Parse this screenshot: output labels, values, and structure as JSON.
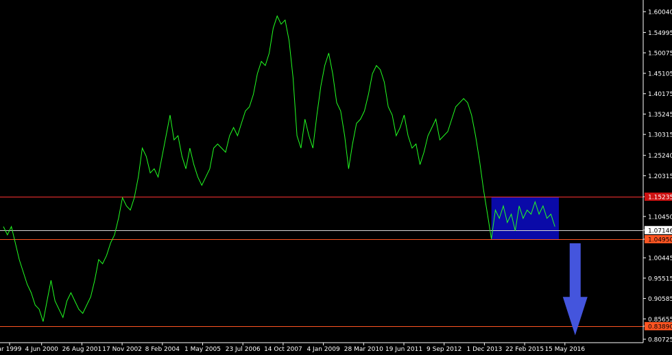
{
  "chart_data": {
    "type": "line",
    "title": "",
    "xlabel": "",
    "ylabel": "",
    "x_ticks": [
      "ar 1999",
      "4 Jun 2000",
      "26 Aug 2001",
      "17 Nov 2002",
      "8 Feb 2004",
      "1 May 2005",
      "23 Jul 2006",
      "14 Oct 2007",
      "4 Jan 2009",
      "28 Mar 2010",
      "19 Jun 2011",
      "9 Sep 2012",
      "1 Dec 2013",
      "22 Feb 2015",
      "15 May 2016"
    ],
    "y_ticks": [
      "1.60040",
      "1.54995",
      "1.50075",
      "1.45105",
      "1.40175",
      "1.35245",
      "1.30315",
      "1.25240",
      "1.20315",
      "1.15235",
      "1.10450",
      "1.07146",
      "1.04950",
      "1.00445",
      "0.95515",
      "0.90585",
      "0.85655",
      "0.83890",
      "0.80725"
    ],
    "ylim": [
      0.80725,
      1.6004
    ],
    "grid": false,
    "series": [
      {
        "color": "#22ff22",
        "points": [
          [
            0,
            1.08
          ],
          [
            0.5,
            1.06
          ],
          [
            1,
            1.08
          ],
          [
            1.5,
            1.04
          ],
          [
            2,
            1.0
          ],
          [
            2.5,
            0.97
          ],
          [
            3,
            0.94
          ],
          [
            3.5,
            0.92
          ],
          [
            4,
            0.89
          ],
          [
            4.5,
            0.88
          ],
          [
            5,
            0.85
          ],
          [
            5.5,
            0.9
          ],
          [
            6,
            0.95
          ],
          [
            6.5,
            0.9
          ],
          [
            7,
            0.88
          ],
          [
            7.5,
            0.86
          ],
          [
            8,
            0.9
          ],
          [
            8.5,
            0.92
          ],
          [
            9,
            0.9
          ],
          [
            9.5,
            0.88
          ],
          [
            10,
            0.87
          ],
          [
            10.5,
            0.89
          ],
          [
            11,
            0.91
          ],
          [
            11.5,
            0.95
          ],
          [
            12,
            1.0
          ],
          [
            12.5,
            0.99
          ],
          [
            13,
            1.01
          ],
          [
            13.5,
            1.04
          ],
          [
            14,
            1.06
          ],
          [
            14.5,
            1.1
          ],
          [
            15,
            1.15
          ],
          [
            15.5,
            1.13
          ],
          [
            16,
            1.12
          ],
          [
            16.5,
            1.15
          ],
          [
            17,
            1.2
          ],
          [
            17.5,
            1.27
          ],
          [
            18,
            1.25
          ],
          [
            18.5,
            1.21
          ],
          [
            19,
            1.22
          ],
          [
            19.5,
            1.2
          ],
          [
            20,
            1.25
          ],
          [
            20.5,
            1.3
          ],
          [
            21,
            1.35
          ],
          [
            21.5,
            1.29
          ],
          [
            22,
            1.3
          ],
          [
            22.5,
            1.25
          ],
          [
            23,
            1.22
          ],
          [
            23.5,
            1.27
          ],
          [
            24,
            1.23
          ],
          [
            24.5,
            1.2
          ],
          [
            25,
            1.18
          ],
          [
            25.5,
            1.2
          ],
          [
            26,
            1.22
          ],
          [
            26.5,
            1.27
          ],
          [
            27,
            1.28
          ],
          [
            27.5,
            1.27
          ],
          [
            28,
            1.26
          ],
          [
            28.5,
            1.3
          ],
          [
            29,
            1.32
          ],
          [
            29.5,
            1.3
          ],
          [
            30,
            1.33
          ],
          [
            30.5,
            1.36
          ],
          [
            31,
            1.37
          ],
          [
            31.5,
            1.4
          ],
          [
            32,
            1.45
          ],
          [
            32.5,
            1.48
          ],
          [
            33,
            1.47
          ],
          [
            33.5,
            1.5
          ],
          [
            34,
            1.56
          ],
          [
            34.5,
            1.59
          ],
          [
            35,
            1.57
          ],
          [
            35.5,
            1.58
          ],
          [
            36,
            1.53
          ],
          [
            36.5,
            1.44
          ],
          [
            37,
            1.3
          ],
          [
            37.5,
            1.27
          ],
          [
            38,
            1.34
          ],
          [
            38.5,
            1.3
          ],
          [
            39,
            1.27
          ],
          [
            39.5,
            1.35
          ],
          [
            40,
            1.42
          ],
          [
            40.5,
            1.47
          ],
          [
            41,
            1.5
          ],
          [
            41.5,
            1.45
          ],
          [
            42,
            1.38
          ],
          [
            42.5,
            1.36
          ],
          [
            43,
            1.3
          ],
          [
            43.5,
            1.22
          ],
          [
            44,
            1.28
          ],
          [
            44.5,
            1.33
          ],
          [
            45,
            1.34
          ],
          [
            45.5,
            1.36
          ],
          [
            46,
            1.4
          ],
          [
            46.5,
            1.45
          ],
          [
            47,
            1.47
          ],
          [
            47.5,
            1.46
          ],
          [
            48,
            1.43
          ],
          [
            48.5,
            1.37
          ],
          [
            49,
            1.35
          ],
          [
            49.5,
            1.3
          ],
          [
            50,
            1.32
          ],
          [
            50.5,
            1.35
          ],
          [
            51,
            1.3
          ],
          [
            51.5,
            1.27
          ],
          [
            52,
            1.28
          ],
          [
            52.5,
            1.23
          ],
          [
            53,
            1.26
          ],
          [
            53.5,
            1.3
          ],
          [
            54,
            1.32
          ],
          [
            54.5,
            1.34
          ],
          [
            55,
            1.29
          ],
          [
            55.5,
            1.3
          ],
          [
            56,
            1.31
          ],
          [
            56.5,
            1.34
          ],
          [
            57,
            1.37
          ],
          [
            57.5,
            1.38
          ],
          [
            58,
            1.39
          ],
          [
            58.5,
            1.38
          ],
          [
            59,
            1.35
          ],
          [
            59.5,
            1.3
          ],
          [
            60,
            1.24
          ],
          [
            60.5,
            1.17
          ],
          [
            61,
            1.11
          ],
          [
            61.5,
            1.05
          ],
          [
            62,
            1.12
          ],
          [
            62.5,
            1.1
          ],
          [
            63,
            1.13
          ],
          [
            63.5,
            1.09
          ],
          [
            64,
            1.11
          ],
          [
            64.5,
            1.07
          ],
          [
            65,
            1.13
          ],
          [
            65.5,
            1.1
          ],
          [
            66,
            1.12
          ],
          [
            66.5,
            1.11
          ],
          [
            67,
            1.14
          ],
          [
            67.5,
            1.11
          ],
          [
            68,
            1.13
          ],
          [
            68.5,
            1.1
          ],
          [
            69,
            1.11
          ],
          [
            69.5,
            1.08
          ]
        ]
      }
    ],
    "levels": [
      {
        "value": 1.15235,
        "label": "1.15235",
        "color": "#ff3333",
        "label_bg": "#cc1111",
        "label_fg": "#ffffff"
      },
      {
        "value": 1.07146,
        "label": "1.07146",
        "color": "#d8d8d8",
        "label_bg": "#ffffff",
        "label_fg": "#000000"
      },
      {
        "value": 1.0495,
        "label": "1.04950",
        "color": "#ff5522",
        "label_bg": "#ff5522",
        "label_fg": "#000000"
      },
      {
        "value": 0.8389,
        "label": "0.83890",
        "color": "#ff5522",
        "label_bg": "#ff5522",
        "label_fg": "#000000"
      }
    ],
    "range_box": {
      "x_start": 61.5,
      "x_end": 70,
      "y_low": 1.0495,
      "y_high": 1.15235,
      "color": "#0a0aa8"
    },
    "arrow": {
      "color": "#4455dd",
      "direction": "down",
      "x": 70.5,
      "y_from": 1.0495,
      "y_to": 0.85
    }
  }
}
